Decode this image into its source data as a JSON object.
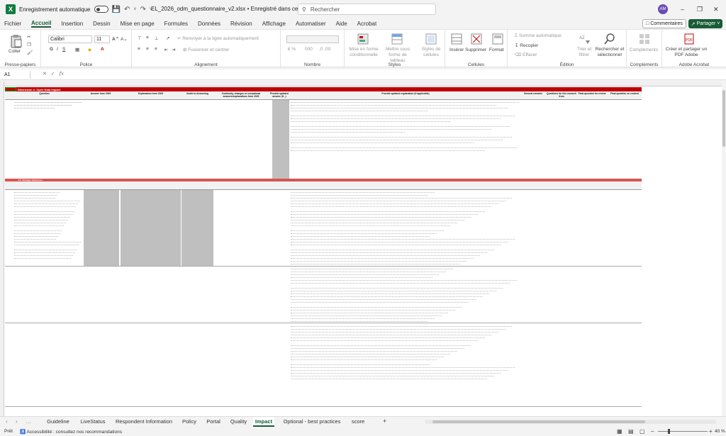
{
  "titlebar": {
    "autosave_label": "Enregistrement automatique",
    "doc_title": "EL_2026_odm_questionnaire_v2.xlsx • Enregistré dans ce PC",
    "search_placeholder": "Rechercher",
    "avatar_initials": "AM"
  },
  "menu": {
    "items": [
      "Fichier",
      "Accueil",
      "Insertion",
      "Dessin",
      "Mise en page",
      "Formules",
      "Données",
      "Révision",
      "Affichage",
      "Automatiser",
      "Aide",
      "Acrobat"
    ],
    "comments_label": "Commentaires",
    "share_label": "Partager"
  },
  "ribbon": {
    "paste_label": "Coller",
    "clipboard_group": "Presse-papiers",
    "font_name": "Calibri",
    "font_size": "11",
    "font_group": "Police",
    "wrap_label": "Renvoyer à la ligne automatiquement",
    "merge_label": "Fusionner et centrer",
    "alignment_group": "Alignement",
    "number_group": "Nombre",
    "cond_format": "Mise en forme conditionnelle",
    "format_table": "Mettre sous forme de tableau",
    "cell_styles": "Styles de cellules",
    "styles_group": "Styles",
    "insert_label": "Insérer",
    "delete_label": "Supprimer",
    "format_label": "Format",
    "cells_group": "Cellules",
    "autosum_label": "Somme automatique",
    "fill_label": "Recopier",
    "clear_label": "Effacer",
    "sort_label": "Trier et filtrer",
    "find_label": "Rechercher et sélectionner",
    "editing_group": "Édition",
    "addins_label": "Compléments",
    "addins_group": "Compléments",
    "pdf_label": "Créer et partager un PDF Adobe",
    "acrobat_group": "Adobe Acrobat"
  },
  "formula_bar": {
    "name_box": "A1",
    "fx_label": "fx"
  },
  "sheet": {
    "title_row": "Dimension 4: Open Data Impact",
    "section2_row": "4.2: Strategic awareness",
    "headers": [
      "Question",
      "Answer from 2025",
      "Explanation from 2025",
      "Guide to Answering",
      "Continuity, changes or exceptional answers/explanations from 2025",
      "Provide updated answer (if...)",
      "Provide updated explanation (if applicable)",
      "General remarks",
      "Questions for the research from",
      "Final question for review",
      "Final question on content"
    ]
  },
  "tabs": {
    "items": [
      "Guideline",
      "LiveStatus",
      "Respondent Information",
      "Policy",
      "Portal",
      "Quality",
      "Impact",
      "Optional - best practices",
      "score"
    ],
    "active": "Impact",
    "add_label": "+"
  },
  "status": {
    "ready": "Prêt",
    "accessibility": "Accessibilité : consultez nos recommandations",
    "zoom": "40 %"
  },
  "colors": {
    "brand_green": "#185c37",
    "header_red": "#c00000",
    "section_red": "#d9534f",
    "header_fill": "#f2f2f2",
    "gray_cell": "#bfbfbf"
  }
}
